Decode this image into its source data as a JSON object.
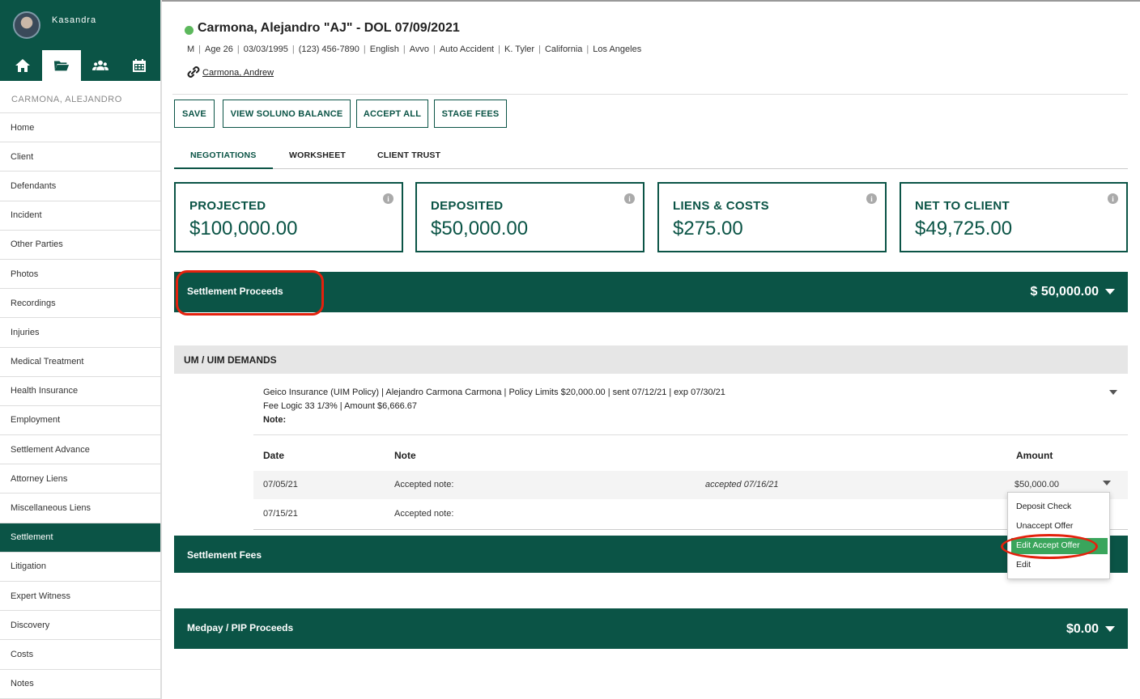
{
  "user": {
    "name": "Kasandra"
  },
  "sidebar": {
    "client_name": "CARMONA, ALEJANDRO",
    "items": [
      {
        "label": "Home"
      },
      {
        "label": "Client"
      },
      {
        "label": "Defendants"
      },
      {
        "label": "Incident"
      },
      {
        "label": "Other Parties"
      },
      {
        "label": "Photos"
      },
      {
        "label": "Recordings"
      },
      {
        "label": "Injuries"
      },
      {
        "label": "Medical Treatment"
      },
      {
        "label": "Health Insurance"
      },
      {
        "label": "Employment"
      },
      {
        "label": "Settlement Advance"
      },
      {
        "label": "Attorney Liens"
      },
      {
        "label": "Miscellaneous Liens"
      },
      {
        "label": "Settlement",
        "active": true
      },
      {
        "label": "Litigation"
      },
      {
        "label": "Expert Witness"
      },
      {
        "label": "Discovery"
      },
      {
        "label": "Costs"
      },
      {
        "label": "Notes"
      }
    ],
    "icons": [
      "home-icon",
      "folder-icon",
      "users-icon",
      "calendar-icon"
    ]
  },
  "case": {
    "title": "Carmona, Alejandro \"AJ\" - DOL 07/09/2021",
    "status_color": "#5cb85c",
    "meta": [
      "M",
      "Age 26",
      "03/03/1995",
      "(123) 456-7890",
      "English",
      "Avvo",
      "Auto Accident",
      "K. Tyler",
      "California",
      "Los Angeles"
    ],
    "related": "Carmona, Andrew"
  },
  "toolbar": {
    "save": "SAVE",
    "view_balance": "VIEW SOLUNO BALANCE",
    "accept_all": "ACCEPT ALL",
    "stage_fees": "STAGE FEES"
  },
  "tabs": {
    "negotiations": "NEGOTIATIONS",
    "worksheet": "WORKSHEET",
    "client_trust": "CLIENT TRUST"
  },
  "cards": {
    "projected": {
      "label": "PROJECTED",
      "value": "$100,000.00"
    },
    "deposited": {
      "label": "DEPOSITED",
      "value": "$50,000.00"
    },
    "liens": {
      "label": "LIENS & COSTS",
      "value": "$275.00"
    },
    "net": {
      "label": "NET TO CLIENT",
      "value": "$49,725.00"
    }
  },
  "sections": {
    "proceeds": {
      "title": "Settlement Proceeds",
      "total": "$ 50,000.00"
    },
    "fees": {
      "title": "Settlement Fees"
    },
    "medpay": {
      "title": "Medpay / PIP Proceeds",
      "total": "$0.00"
    }
  },
  "um": {
    "title": "UM / UIM DEMANDS",
    "line1": "Geico Insurance (UIM Policy) | Alejandro Carmona Carmona | Policy Limits $20,000.00 | sent 07/12/21 | exp 07/30/21",
    "line2": "Fee Logic 33 1/3% | Amount $6,666.67",
    "line3": "Note:",
    "columns": {
      "date": "Date",
      "note": "Note",
      "amount": "Amount"
    },
    "rows": [
      {
        "date": "07/05/21",
        "note": "Accepted note:",
        "status": "accepted 07/16/21",
        "amount": "$50,000.00"
      },
      {
        "date": "07/15/21",
        "note": "Accepted note:",
        "status": "",
        "amount": ""
      }
    ]
  },
  "dropdown": {
    "items": [
      "Deposit Check",
      "Unaccept Offer",
      "Edit Accept Offer",
      "Edit"
    ],
    "highlight_color": "#e4210d",
    "active_color": "#3aa55c"
  },
  "colors": {
    "brand": "#0b5446"
  }
}
